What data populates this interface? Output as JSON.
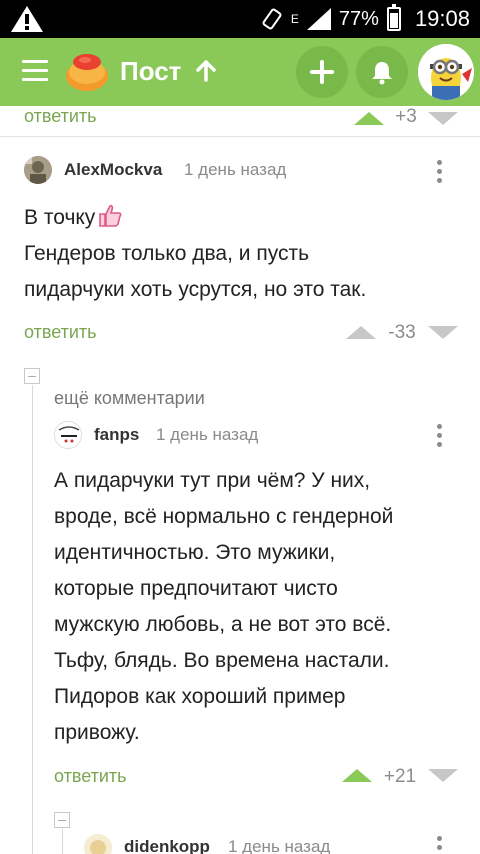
{
  "status_bar": {
    "network": "E",
    "battery": "77%",
    "time": "19:08"
  },
  "app_bar": {
    "title": "Пост",
    "menu_icon": "hamburger-icon",
    "add_icon": "plus-icon",
    "bell_icon": "bell-icon",
    "brand_color": "#8ac858"
  },
  "top_row": {
    "reply_label": "ответить",
    "score": "+3"
  },
  "comments": [
    {
      "author": "AlexMockva",
      "time": "1 день назад",
      "lines": [
        "В точку",
        "Гендеров только два, и пусть",
        "пидарчуки хоть усрутся, но это так."
      ],
      "reply_label": "ответить",
      "score": "-33"
    },
    {
      "author": "fanps",
      "time": "1 день назад",
      "lines": [
        "А пидарчуки тут при чём? У них,",
        "вроде, всё нормально с гендерной",
        "идентичностью. Это мужики,",
        "которые предпочитают чисто",
        "мужскую любовь, а не вот это всё.",
        "Тьфу, блядь. Во времена настали.",
        "Пидоров как хороший пример",
        "привожу."
      ],
      "reply_label": "ответить",
      "score": "+21"
    },
    {
      "author": "didenkopp",
      "time": "1 день назад"
    }
  ],
  "more_comments_label": "ещё комментарии",
  "colors": {
    "accent_green": "#7aa550",
    "upvote_active": "#8ac858",
    "vote_inactive": "#c7c7c7"
  }
}
